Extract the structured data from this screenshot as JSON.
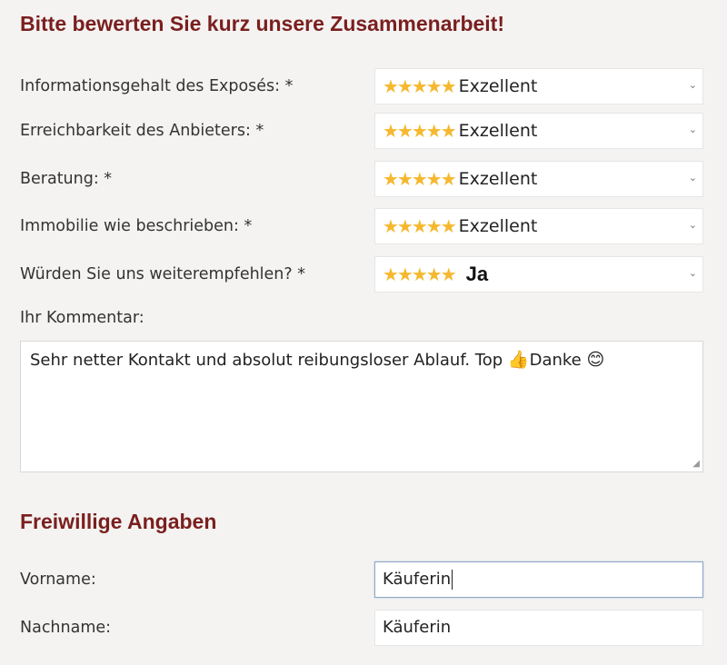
{
  "heading": "Bitte bewerten Sie kurz unsere Zusammenarbeit!",
  "ratings": [
    {
      "label": "Informationsgehalt des Exposés: *",
      "stars": "★★★★★",
      "value": "Exzellent"
    },
    {
      "label": "Erreichbarkeit des Anbieters: *",
      "stars": "★★★★★",
      "value": "Exzellent"
    },
    {
      "label": "Beratung: *",
      "stars": "★★★★★",
      "value": "Exzellent"
    },
    {
      "label": "Immobilie wie beschrieben: *",
      "stars": "★★★★★",
      "value": "Exzellent"
    },
    {
      "label": "Würden Sie uns weiterempfehlen? *",
      "stars": "★★★★★",
      "value": "Ja"
    }
  ],
  "comment": {
    "label": "Ihr Kommentar:",
    "text_before": "Sehr netter Kontakt und absolut reibungsloser Ablauf. Top ",
    "emoji_thumb": "👍",
    "text_middle": "Danke ",
    "emoji_smile": "😊"
  },
  "optional": {
    "heading": "Freiwillige Angaben",
    "first_name_label": "Vorname:",
    "first_name_value": "Käuferin",
    "last_name_label": "Nachname:",
    "last_name_value": "Käuferin"
  },
  "colors": {
    "heading": "#7a1f1f",
    "star": "#f5b82e",
    "background": "#f4f3f1"
  },
  "icons": {
    "select_arrow": "chevron-down-icon",
    "star": "star-icon"
  }
}
